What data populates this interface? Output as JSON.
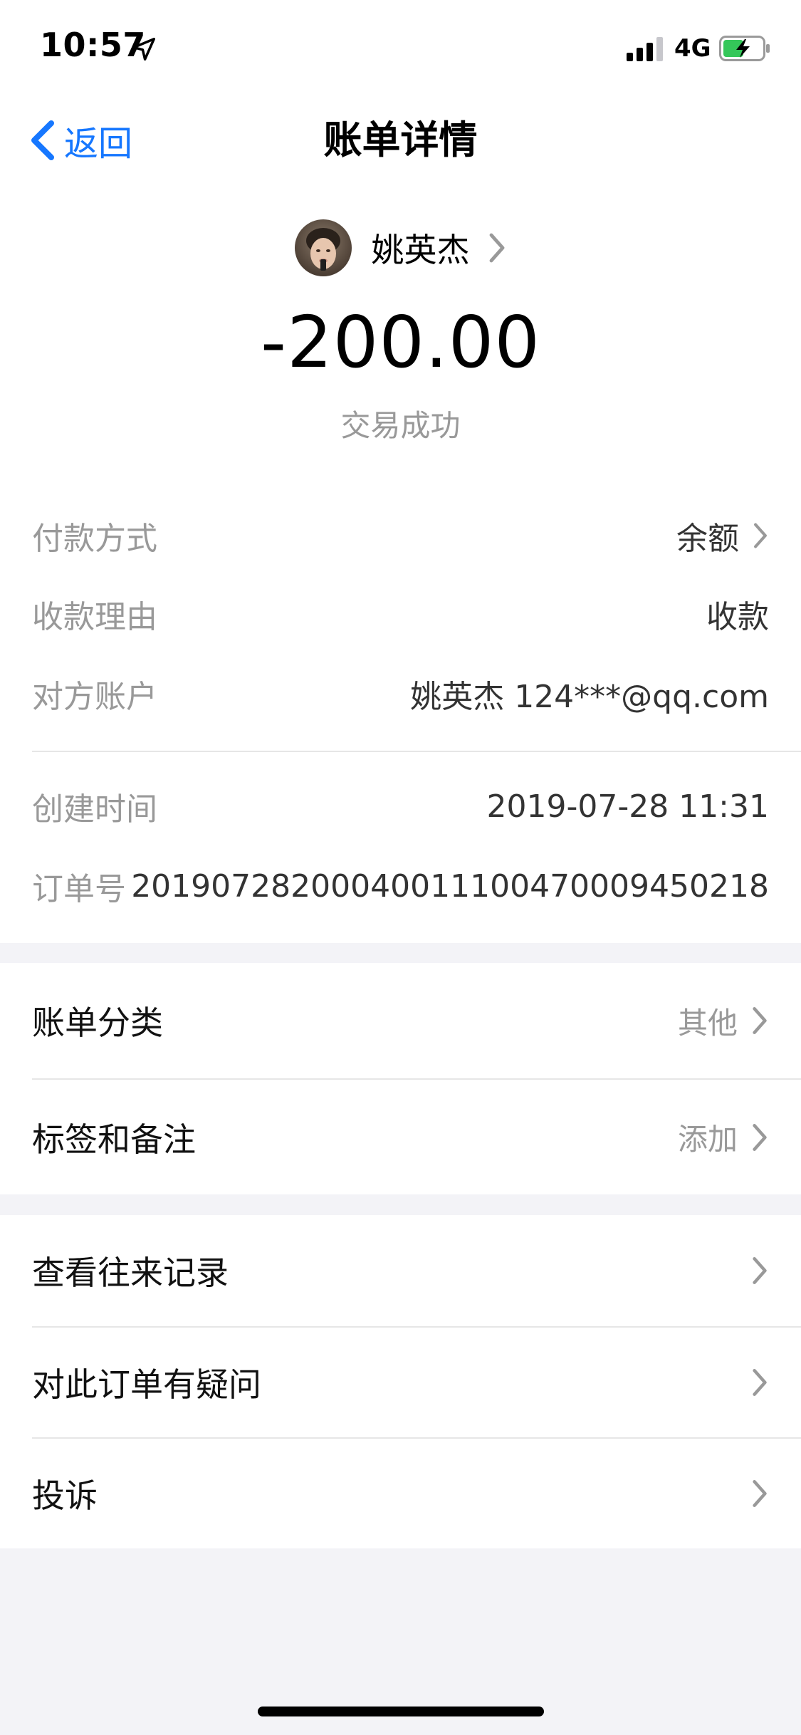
{
  "status_bar": {
    "time": "10:57",
    "network": "4G",
    "icons": [
      "location-arrow-icon",
      "signal-icon",
      "battery-charging-icon"
    ],
    "battery_color": "#34c759"
  },
  "nav": {
    "back_label": "返回",
    "title": "账单详情"
  },
  "summary": {
    "payee_name": "姚英杰",
    "amount": "-200.00",
    "status": "交易成功"
  },
  "details": {
    "payment_method_label": "付款方式",
    "payment_method_value": "余额",
    "reason_label": "收款理由",
    "reason_value": "收款",
    "counterparty_label": "对方账户",
    "counterparty_value": "姚英杰 124***@qq.com",
    "created_label": "创建时间",
    "created_value": "2019-07-28 11:31",
    "order_label": "订单号",
    "order_value": "20190728200040011100470009450218"
  },
  "category_block": {
    "category_label": "账单分类",
    "category_value": "其他",
    "tags_label": "标签和备注",
    "tags_value": "添加"
  },
  "actions_block": {
    "history_label": "查看往来记录",
    "question_label": "对此订单有疑问",
    "complaint_label": "投诉"
  },
  "colors": {
    "accent": "#1677ff",
    "background": "#f3f3f7",
    "muted_text": "#999999"
  }
}
